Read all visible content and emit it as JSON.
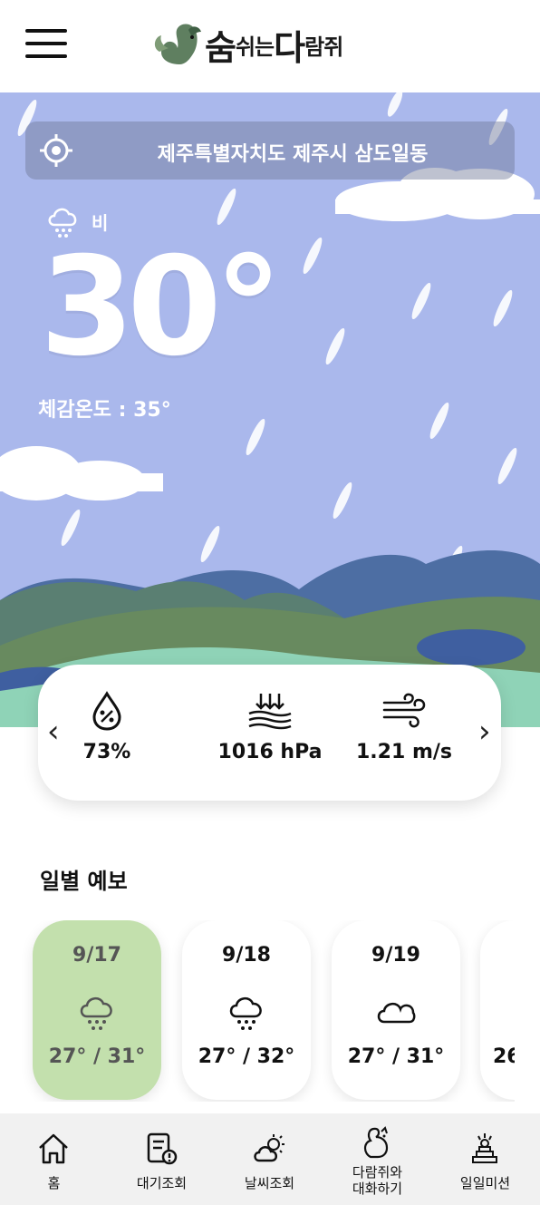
{
  "header": {
    "brand_part1": "숨",
    "brand_part2": "쉬는",
    "brand_part3": "다",
    "brand_part4": "람쥐"
  },
  "hero": {
    "location": "제주특별자치도 제주시 삼도일동",
    "condition": "비",
    "condition_icon": "rain-cloud-icon",
    "temperature": "30°",
    "feels_like": "체감온도 : 35°",
    "sky_color": "#aab8ec"
  },
  "metrics": [
    {
      "icon": "humidity-icon",
      "value": "73%"
    },
    {
      "icon": "pressure-icon",
      "value": "1016 hPa"
    },
    {
      "icon": "wind-icon",
      "value": "1.21 m/s"
    }
  ],
  "forecast": {
    "title": "일별 예보",
    "days": [
      {
        "date": "9/17",
        "icon": "rain-cloud-icon",
        "range": "27° / 31°",
        "active": true
      },
      {
        "date": "9/18",
        "icon": "rain-cloud-icon",
        "range": "27° / 32°",
        "active": false
      },
      {
        "date": "9/19",
        "icon": "cloud-icon",
        "range": "27° / 31°",
        "active": false
      },
      {
        "date": "",
        "icon": "",
        "range": "26",
        "active": false
      }
    ]
  },
  "nav": [
    {
      "label": "홈",
      "icon": "home-icon"
    },
    {
      "label": "대기조회",
      "icon": "air-report-icon"
    },
    {
      "label": "날씨조회",
      "icon": "weather-icon"
    },
    {
      "label_line1": "다람쥐와",
      "label_line2": "대화하기",
      "icon": "squirrel-icon"
    },
    {
      "label": "일일미션",
      "icon": "mission-trophy-icon"
    }
  ],
  "colors": {
    "active_day": "#c3e0ad",
    "nav_bg": "#f1f1f1"
  }
}
